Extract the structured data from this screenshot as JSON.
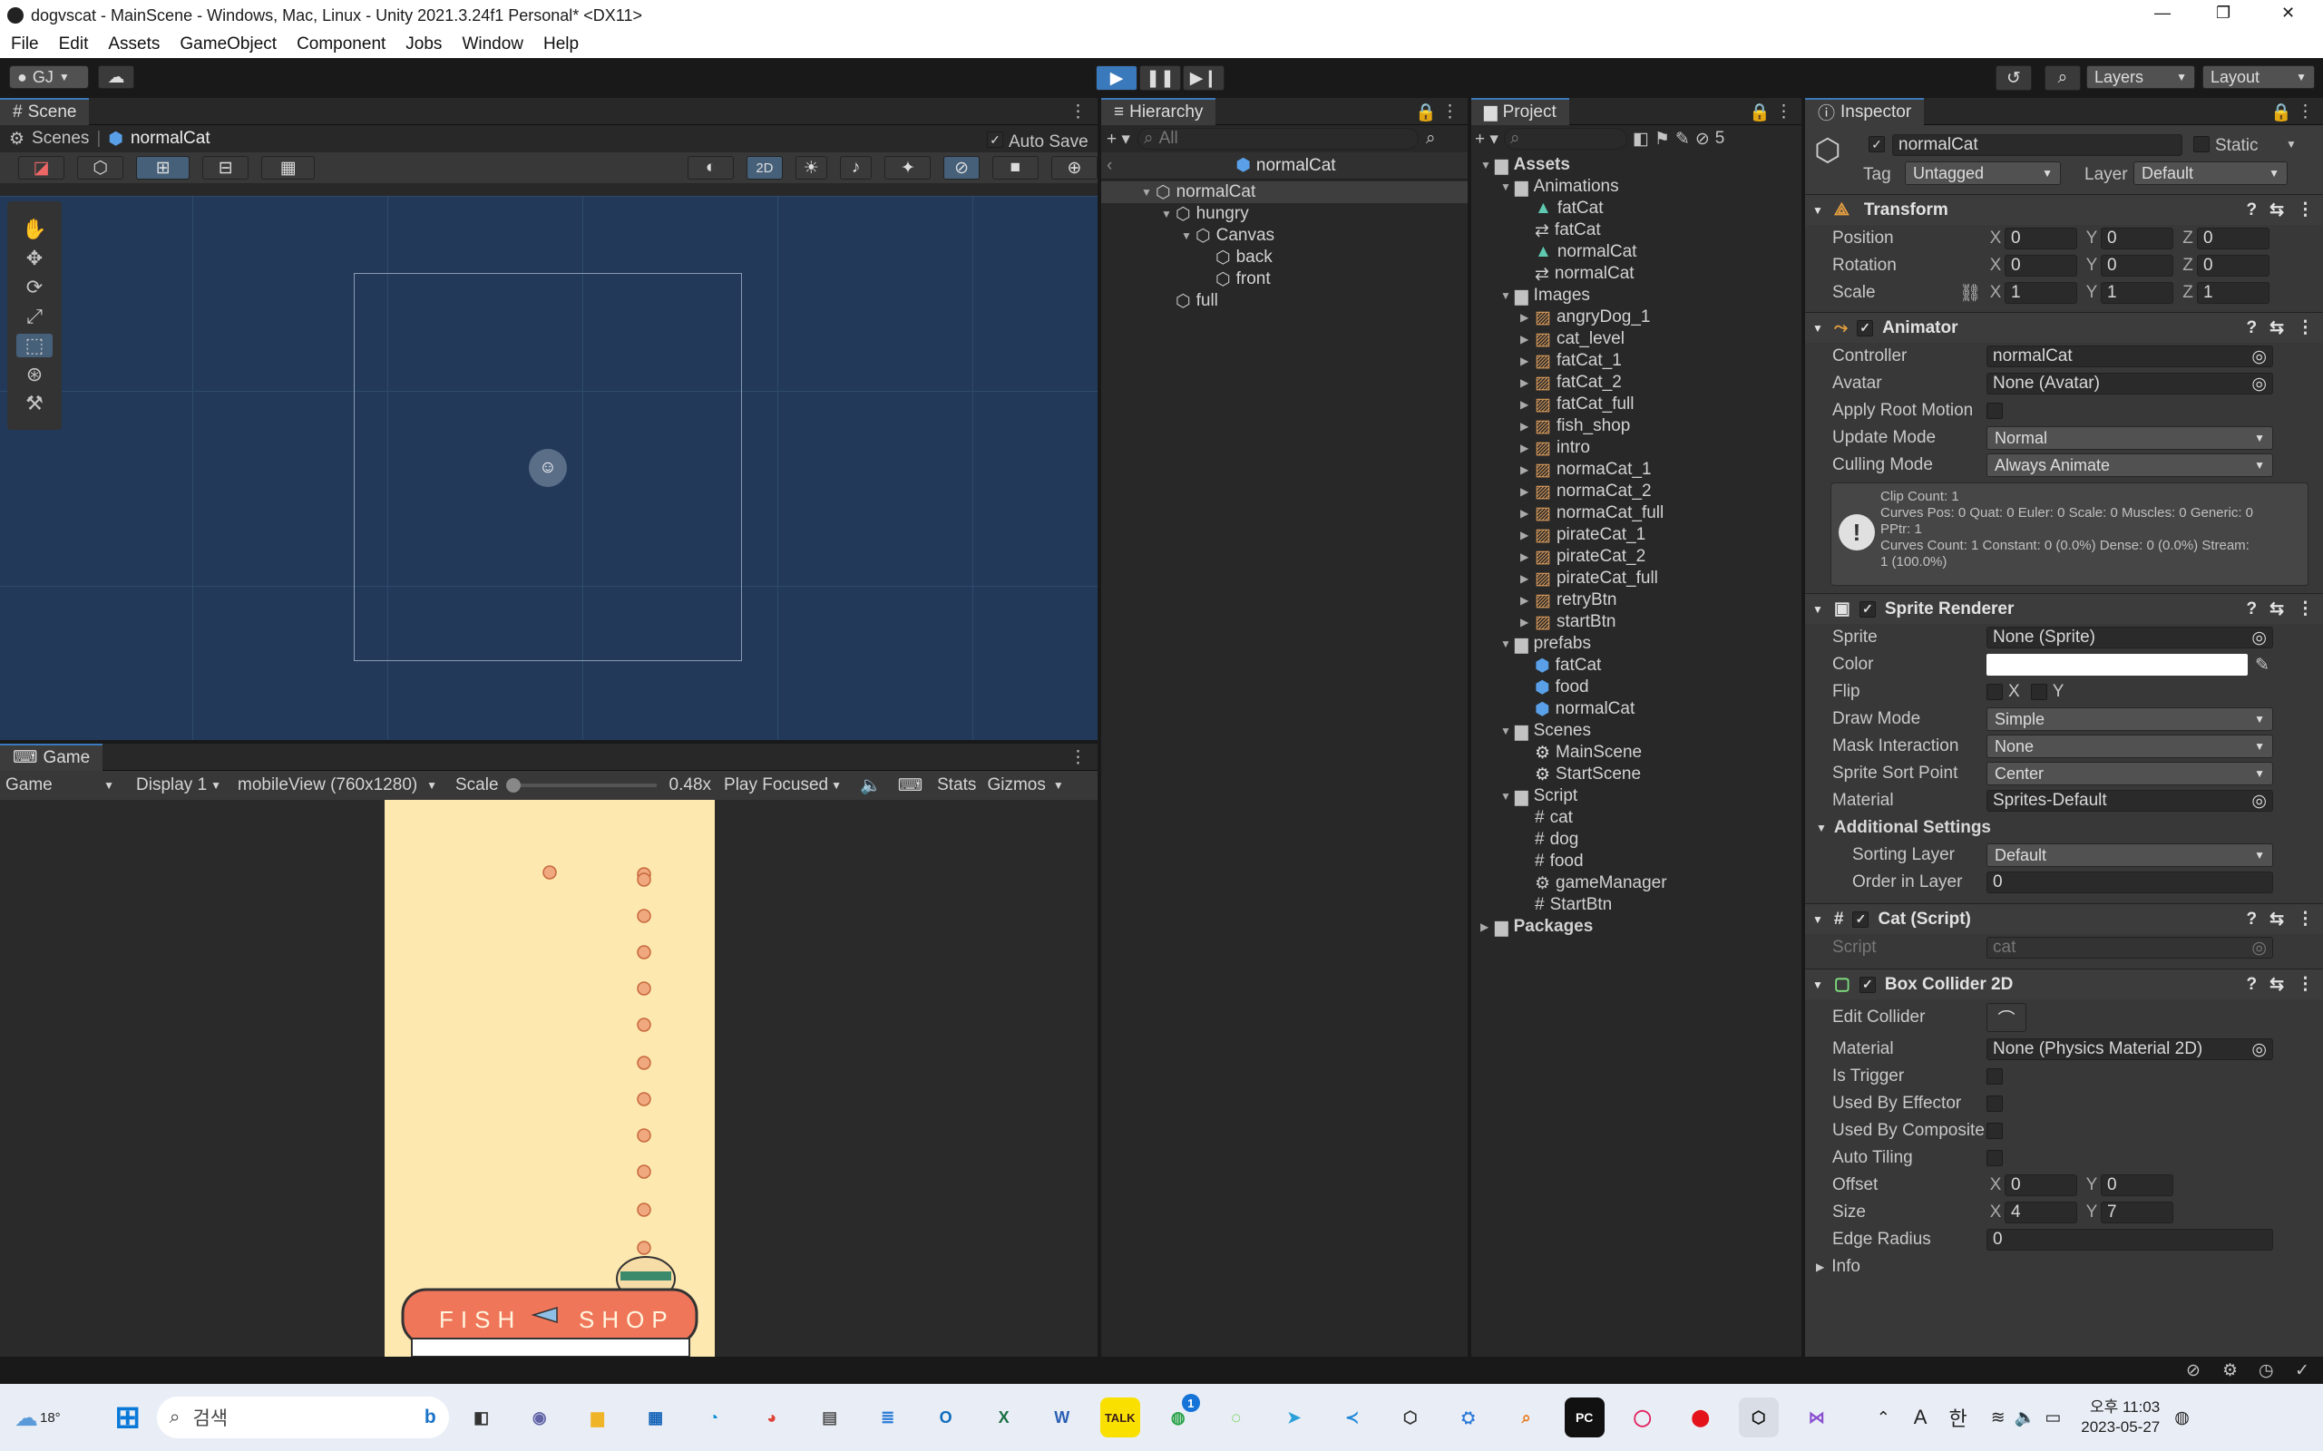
{
  "window": {
    "title": "dogvscat - MainScene - Windows, Mac, Linux - Unity 2021.3.24f1 Personal* <DX11>",
    "min": "—",
    "max": "❐",
    "close": "✕"
  },
  "menu": [
    "File",
    "Edit",
    "Assets",
    "GameObject",
    "Component",
    "Jobs",
    "Window",
    "Help"
  ],
  "toolbar": {
    "account": "GJ",
    "layers": "Layers",
    "layout": "Layout"
  },
  "scene": {
    "tab": "Scene",
    "breadcrumb_root": "Scenes",
    "breadcrumb_item": "normalCat",
    "auto_save": "Auto Save",
    "mode2d": "2D"
  },
  "game": {
    "tab": "Game",
    "view": "Game",
    "display": "Display 1",
    "resolution": "mobileView (760x1280)",
    "scale_label": "Scale",
    "scale_value": "0.48x",
    "play_focused": "Play Focused",
    "stats": "Stats",
    "gizmos": "Gizmos",
    "shop_left": "FISH",
    "shop_right": "SHOP"
  },
  "hierarchy": {
    "tab": "Hierarchy",
    "search": "All",
    "root": "normalCat",
    "items": [
      {
        "label": "normalCat",
        "indent": 0
      },
      {
        "label": "hungry",
        "indent": 1
      },
      {
        "label": "Canvas",
        "indent": 2
      },
      {
        "label": "back",
        "indent": 3
      },
      {
        "label": "front",
        "indent": 3
      },
      {
        "label": "full",
        "indent": 1
      }
    ]
  },
  "project": {
    "tab": "Project",
    "hidden_count": "5",
    "items": [
      {
        "label": "Assets",
        "indent": 0,
        "kind": "folder",
        "bold": true
      },
      {
        "label": "Animations",
        "indent": 1,
        "kind": "folder"
      },
      {
        "label": "fatCat",
        "indent": 2,
        "kind": "anim"
      },
      {
        "label": "fatCat",
        "indent": 2,
        "kind": "ctrl"
      },
      {
        "label": "normalCat",
        "indent": 2,
        "kind": "anim"
      },
      {
        "label": "normalCat",
        "indent": 2,
        "kind": "ctrl"
      },
      {
        "label": "Images",
        "indent": 1,
        "kind": "folder"
      },
      {
        "label": "angryDog_1",
        "indent": 2,
        "kind": "img"
      },
      {
        "label": "cat_level",
        "indent": 2,
        "kind": "img"
      },
      {
        "label": "fatCat_1",
        "indent": 2,
        "kind": "img"
      },
      {
        "label": "fatCat_2",
        "indent": 2,
        "kind": "img"
      },
      {
        "label": "fatCat_full",
        "indent": 2,
        "kind": "img"
      },
      {
        "label": "fish_shop",
        "indent": 2,
        "kind": "img"
      },
      {
        "label": "intro",
        "indent": 2,
        "kind": "img"
      },
      {
        "label": "normaCat_1",
        "indent": 2,
        "kind": "img"
      },
      {
        "label": "normaCat_2",
        "indent": 2,
        "kind": "img"
      },
      {
        "label": "normaCat_full",
        "indent": 2,
        "kind": "img"
      },
      {
        "label": "pirateCat_1",
        "indent": 2,
        "kind": "img"
      },
      {
        "label": "pirateCat_2",
        "indent": 2,
        "kind": "img"
      },
      {
        "label": "pirateCat_full",
        "indent": 2,
        "kind": "img"
      },
      {
        "label": "retryBtn",
        "indent": 2,
        "kind": "img"
      },
      {
        "label": "startBtn",
        "indent": 2,
        "kind": "img"
      },
      {
        "label": "prefabs",
        "indent": 1,
        "kind": "folder"
      },
      {
        "label": "fatCat",
        "indent": 2,
        "kind": "prefab"
      },
      {
        "label": "food",
        "indent": 2,
        "kind": "prefab"
      },
      {
        "label": "normalCat",
        "indent": 2,
        "kind": "prefab"
      },
      {
        "label": "Scenes",
        "indent": 1,
        "kind": "folder"
      },
      {
        "label": "MainScene",
        "indent": 2,
        "kind": "scene"
      },
      {
        "label": "StartScene",
        "indent": 2,
        "kind": "scene"
      },
      {
        "label": "Script",
        "indent": 1,
        "kind": "folder"
      },
      {
        "label": "cat",
        "indent": 2,
        "kind": "script"
      },
      {
        "label": "dog",
        "indent": 2,
        "kind": "script"
      },
      {
        "label": "food",
        "indent": 2,
        "kind": "script"
      },
      {
        "label": "gameManager",
        "indent": 2,
        "kind": "gear"
      },
      {
        "label": "StartBtn",
        "indent": 2,
        "kind": "script"
      },
      {
        "label": "Packages",
        "indent": 0,
        "kind": "folder",
        "bold": true
      }
    ]
  },
  "inspector": {
    "tab": "Inspector",
    "name": "normalCat",
    "static": "Static",
    "tag_label": "Tag",
    "tag": "Untagged",
    "layer_label": "Layer",
    "layer": "Default",
    "transform": {
      "title": "Transform",
      "position_label": "Position",
      "rotation_label": "Rotation",
      "scale_label": "Scale",
      "position": [
        "0",
        "0",
        "0"
      ],
      "rotation": [
        "0",
        "0",
        "0"
      ],
      "scale": [
        "1",
        "1",
        "1"
      ]
    },
    "animator": {
      "title": "Animator",
      "controller_label": "Controller",
      "controller": "normalCat",
      "avatar_label": "Avatar",
      "avatar": "None (Avatar)",
      "root_motion_label": "Apply Root Motion",
      "update_label": "Update Mode",
      "update": "Normal",
      "culling_label": "Culling Mode",
      "culling": "Always Animate",
      "info": [
        "Clip Count: 1",
        "Curves Pos: 0 Quat: 0 Euler: 0 Scale: 0 Muscles: 0 Generic: 0",
        "PPtr: 1",
        "Curves Count: 1 Constant: 0 (0.0%) Dense: 0 (0.0%) Stream:",
        "1 (100.0%)"
      ]
    },
    "sprite": {
      "title": "Sprite Renderer",
      "sprite_label": "Sprite",
      "sprite": "None (Sprite)",
      "color_label": "Color",
      "flip_label": "Flip",
      "flip_x": "X",
      "flip_y": "Y",
      "draw_label": "Draw Mode",
      "draw": "Simple",
      "mask_label": "Mask Interaction",
      "mask": "None",
      "sort_point_label": "Sprite Sort Point",
      "sort_point": "Center",
      "material_label": "Material",
      "material": "Sprites-Default",
      "additional": "Additional Settings",
      "sorting_layer_label": "Sorting Layer",
      "sorting_layer": "Default",
      "order_label": "Order in Layer",
      "order": "0"
    },
    "cat_script": {
      "title": "Cat (Script)",
      "script_label": "Script",
      "script": "cat"
    },
    "collider": {
      "title": "Box Collider 2D",
      "edit_label": "Edit Collider",
      "material_label": "Material",
      "material": "None (Physics Material 2D)",
      "trigger_label": "Is Trigger",
      "effector_label": "Used By Effector",
      "composite_label": "Used By Composite",
      "tiling_label": "Auto Tiling",
      "offset_label": "Offset",
      "offset": [
        "0",
        "0"
      ],
      "size_label": "Size",
      "size": [
        "4",
        "7"
      ],
      "edge_label": "Edge Radius",
      "edge": "0",
      "info": "Info"
    }
  },
  "taskbar": {
    "temp": "18°",
    "search": "검색",
    "ime_a": "A",
    "ime_han": "한",
    "time": "오후 11:03",
    "date": "2023-05-27",
    "whatsapp_badge": "1"
  }
}
